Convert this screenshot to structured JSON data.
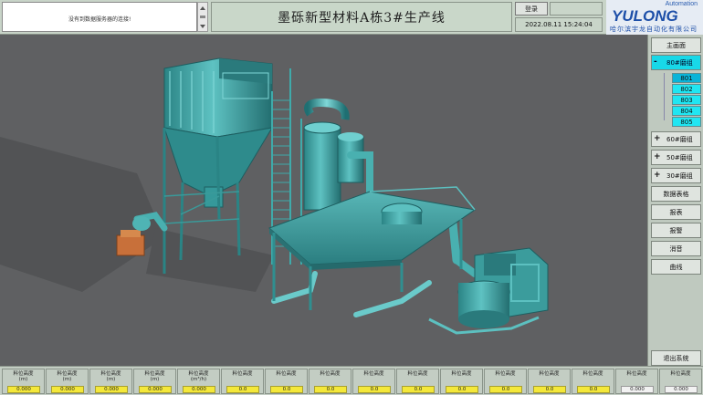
{
  "header": {
    "alarm_message": "没有到数据服务器的连接!",
    "title": "墨砾新型材料A栋3#生产线",
    "login_label": "登录",
    "datetime": "2022.08.11 15:24:04",
    "logo_tagline": "Automation",
    "logo_name": "YULONG",
    "logo_company": "哈尔滨宇龙自动化有限公司"
  },
  "sidebar": {
    "main_screen": "主画面",
    "group_80": "80#磨组",
    "mills_80": [
      "801",
      "802",
      "803",
      "804",
      "805"
    ],
    "group_60": "60#磨组",
    "group_50": "50#磨组",
    "group_30": "30#磨组",
    "data_table": "数据表格",
    "report": "报表",
    "alarm": "报警",
    "silence": "消音",
    "curve": "曲线",
    "exit": "退出系统",
    "expanded_sign": "-",
    "collapsed_sign": "+"
  },
  "bottom_table": {
    "cells": [
      {
        "label": "料位高度",
        "unit": "(m)",
        "value": "0.000",
        "style": "yellow"
      },
      {
        "label": "料位高度",
        "unit": "(m)",
        "value": "0.000",
        "style": "yellow"
      },
      {
        "label": "料位高度",
        "unit": "(m)",
        "value": "0.000",
        "style": "yellow"
      },
      {
        "label": "料位高度",
        "unit": "(m)",
        "value": "0.000",
        "style": "yellow"
      },
      {
        "label": "料位高度",
        "unit": "(m³/h)",
        "value": "0.000",
        "style": "yellow"
      },
      {
        "label": "料位高度",
        "unit": "",
        "value": "0.0",
        "style": "yellow"
      },
      {
        "label": "料位高度",
        "unit": "",
        "value": "0.0",
        "style": "yellow"
      },
      {
        "label": "料位高度",
        "unit": "",
        "value": "0.0",
        "style": "yellow"
      },
      {
        "label": "料位高度",
        "unit": "",
        "value": "0.0",
        "style": "yellow"
      },
      {
        "label": "料位高度",
        "unit": "",
        "value": "0.0",
        "style": "yellow"
      },
      {
        "label": "料位高度",
        "unit": "",
        "value": "0.0",
        "style": "yellow"
      },
      {
        "label": "料位高度",
        "unit": "",
        "value": "0.0",
        "style": "yellow"
      },
      {
        "label": "料位高度",
        "unit": "",
        "value": "0.0",
        "style": "yellow"
      },
      {
        "label": "料位高度",
        "unit": "",
        "value": "0.0",
        "style": "yellow"
      },
      {
        "label": "料位高度",
        "unit": "",
        "value": "0.000",
        "style": "white"
      },
      {
        "label": "料位高度",
        "unit": "",
        "value": "0.000",
        "style": "white"
      }
    ]
  },
  "colors": {
    "equipment": "#2f8f8f",
    "equipment_light": "#6fcfcf",
    "background": "#5f6062",
    "active_tab": "#18d8e8",
    "value_yellow": "#f4e83a"
  }
}
